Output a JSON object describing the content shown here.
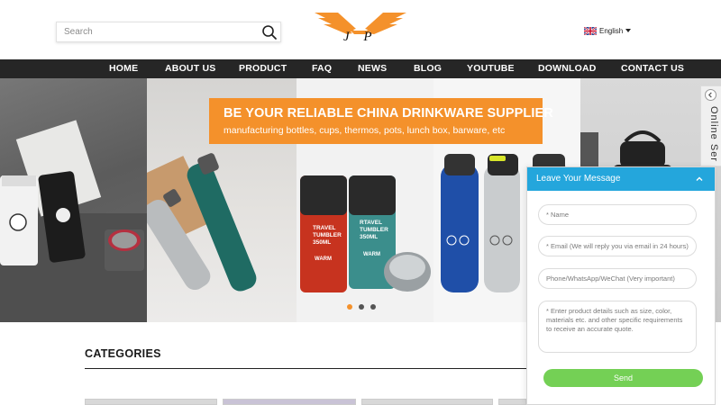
{
  "header": {
    "search": {
      "placeholder": "Search",
      "icon": "search-icon"
    },
    "logo": {
      "text": "J P",
      "color": "#f4912b"
    },
    "language": {
      "label": "English",
      "flag": "uk-flag-icon"
    }
  },
  "nav": {
    "items": [
      "HOME",
      "ABOUT US",
      "PRODUCT",
      "FAQ",
      "NEWS",
      "BLOG",
      "YOUTUBE",
      "DOWNLOAD",
      "CONTACT US"
    ]
  },
  "banner": {
    "headline": "BE YOUR RELIABLE CHINA DRINKWARE SUPPLIER",
    "subline": "manufacturing bottles, cups, thermos, pots, lunch box, barware, etc",
    "tumbler_labels": [
      "TRAVEL\nTUMBLER\n350ML",
      "RTAVEL\nTUMBLER\n350ML"
    ],
    "brand_marks": [
      "WARM",
      "WARM"
    ],
    "slide_count": 3,
    "active_slide": 1,
    "accent": "#f4912b"
  },
  "online_service": {
    "label": "Online Ser"
  },
  "categories": {
    "title": "CATEGORIES"
  },
  "message_panel": {
    "title": "Leave Your Message",
    "header_color": "#24a6dc",
    "fields": {
      "name": "* Name",
      "email": "* Email (We will reply you via email in 24 hours)",
      "phone": "Phone/WhatsApp/WeChat (Very important)",
      "details": "* Enter product details such as size, color, materials etc. and other specific requirements to receive an accurate quote."
    },
    "send_label": "Send",
    "send_color": "#74d055"
  }
}
